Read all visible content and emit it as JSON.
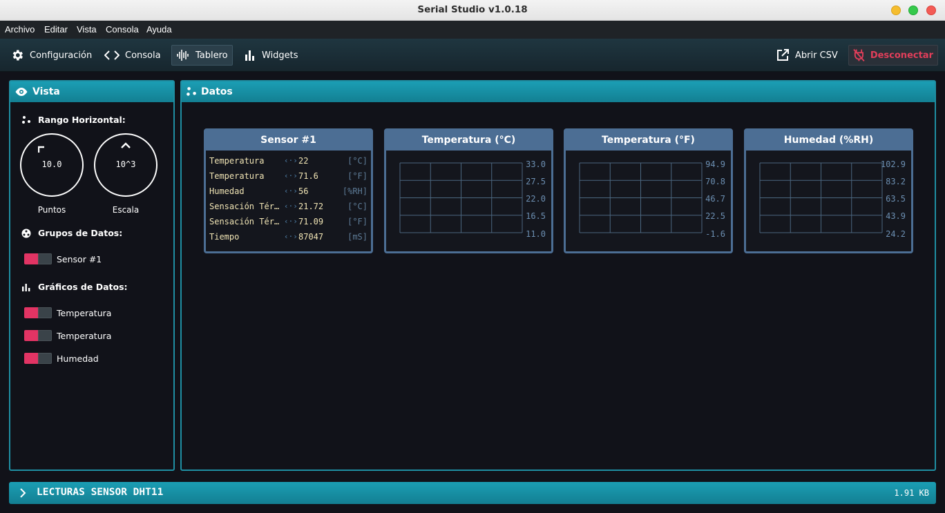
{
  "window": {
    "title": "Serial Studio v1.0.18"
  },
  "menu": [
    "Archivo",
    "Editar",
    "Vista",
    "Consola",
    "Ayuda"
  ],
  "toolbar": {
    "config": "Configuración",
    "console": "Consola",
    "dashboard": "Tablero",
    "widgets": "Widgets",
    "open_csv": "Abrir CSV",
    "disconnect": "Desconectar"
  },
  "view_panel": {
    "title": "Vista",
    "horizontal_range": "Rango Horizontal:",
    "points_value": "10.0",
    "points_label": "Puntos",
    "scale_value": "10^3",
    "scale_label": "Escala",
    "groups_title": "Grupos de Datos:",
    "groups": [
      "Sensor #1"
    ],
    "plots_title": "Gráficos de Datos:",
    "plots": [
      "Temperatura",
      "Temperatura",
      "Humedad"
    ]
  },
  "data_panel": {
    "title": "Datos",
    "group": {
      "title": "Sensor #1",
      "rows": [
        {
          "name": "Temperatura",
          "value": "22",
          "unit": "[°C]"
        },
        {
          "name": "Temperatura",
          "value": "71.6",
          "unit": "[°F]"
        },
        {
          "name": "Humedad",
          "value": "56",
          "unit": "[%RH]"
        },
        {
          "name": "Sensación Térmica",
          "value": "21.72",
          "unit": "[°C]"
        },
        {
          "name": "Sensación Térmica",
          "value": "71.09",
          "unit": "[°F]"
        },
        {
          "name": "Tiempo",
          "value": "87047",
          "unit": "[mS]"
        }
      ]
    },
    "plots": [
      {
        "title": "Temperatura (°C)",
        "ticks": [
          "33.0",
          "27.5",
          "22.0",
          "16.5",
          "11.0"
        ]
      },
      {
        "title": "Temperatura (°F)",
        "ticks": [
          "94.9",
          "70.8",
          "46.7",
          "22.5",
          "-1.6"
        ]
      },
      {
        "title": "Humedad (%RH)",
        "ticks": [
          "102.9",
          "83.2",
          "63.5",
          "43.9",
          "24.2"
        ]
      }
    ]
  },
  "console_bar": {
    "label": "LECTURAS SENSOR DHT11",
    "size": "1.91 KB"
  }
}
